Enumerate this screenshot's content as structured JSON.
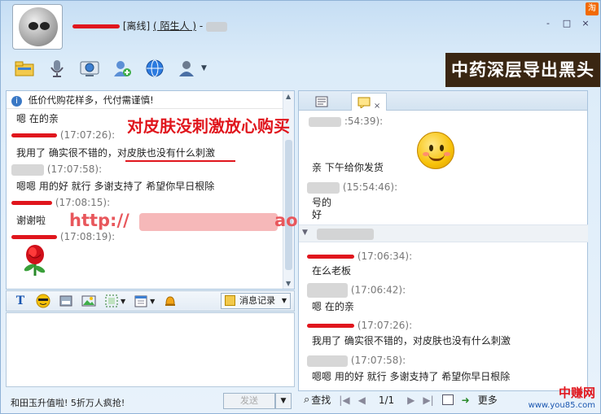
{
  "header": {
    "status_text": "[离线]",
    "relation": "( 陌生人 )",
    "dash": "-",
    "corner_tag": "淘"
  },
  "window_controls": [
    "-",
    "□",
    "×"
  ],
  "toolbar": {
    "icons": [
      "folder-icon",
      "microphone-icon",
      "webcam-icon",
      "add-contact-icon",
      "globe-icon",
      "user-settings-icon"
    ]
  },
  "banner": {
    "text": "中药深层导出黑头"
  },
  "left_chat": {
    "notice": "低价代购花样多，代付需谨慎!",
    "messages": [
      {
        "text": "嗯 在的亲"
      },
      {
        "time": "(17:07:26):",
        "text": "我用了 确实很不错的，对皮肤也没有什么刺激"
      },
      {
        "time": "(17:07:58):",
        "text": "嗯嗯   用的好  就行  多谢支持了    希望你早日根除"
      },
      {
        "time": "(17:08:15):",
        "text": "谢谢啦"
      },
      {
        "time": "(17:08:19):",
        "text": ""
      }
    ],
    "overlay_title": "对皮肤没刺激放心购买",
    "url_prefix": "http://",
    "url_suffix": "ao"
  },
  "format_bar": {
    "icons": [
      "font-icon",
      "emoticon-icon",
      "screenshot-icon",
      "image-icon",
      "screen-capture-icon",
      "calendar-icon",
      "bell-icon"
    ],
    "history_button": "消息记录"
  },
  "bottom": {
    "promo": "和田玉升值啦! 5折万人疯抢!",
    "send": "发送",
    "find": "查找",
    "page": "1/1",
    "more": "更多"
  },
  "right_chat": {
    "messages": [
      {
        "time": ":54:39):",
        "text": ""
      },
      {
        "time": "",
        "text": "亲  下午给你发货"
      },
      {
        "time": "(15:54:46):",
        "text": "号的"
      },
      {
        "time": "",
        "text": "好"
      },
      {
        "time": "(17:06:34):",
        "text": "在么老板"
      },
      {
        "time": "(17:06:42):",
        "text": "嗯 在的亲"
      },
      {
        "time": "(17:07:26):",
        "text": "我用了  确实很不错的，对皮肤也没有什么刺激"
      },
      {
        "time": "(17:07:58):",
        "text": "嗯嗯    用的好  就行  多谢支持了    希望你早日根除"
      }
    ]
  },
  "watermark": {
    "line1": "中赚网",
    "line2": "www.you85.com"
  },
  "colors": {
    "accent_red": "#e0161d",
    "window_blue": "#c6def4",
    "banner_bg": "#3a2612"
  }
}
